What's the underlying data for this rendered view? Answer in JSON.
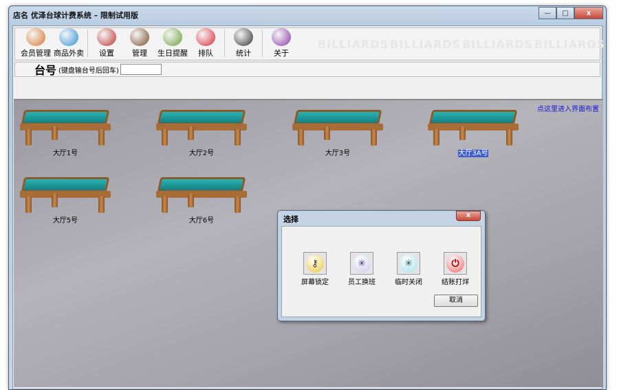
{
  "window": {
    "title": "店名 优泽台球计费系统  – 限制试用版",
    "minimize": "—",
    "maximize": "□",
    "close": "x"
  },
  "toolbar": {
    "watermark": "BILLIARDS",
    "items": [
      {
        "label": "会员管理",
        "icon": "members-icon",
        "color": "#d9732d"
      },
      {
        "label": "商品外卖",
        "icon": "pie-chart-icon",
        "color": "#2c8fd6"
      },
      {
        "label": "设置",
        "icon": "tools-icon",
        "color": "#b33"
      },
      {
        "label": "管理",
        "icon": "manager-icon",
        "color": "#7a4b2a"
      },
      {
        "label": "生日提醒",
        "icon": "group-icon",
        "color": "#6b9d3a"
      },
      {
        "label": "排队",
        "icon": "chart-down-icon",
        "color": "#d8283a"
      },
      {
        "label": "统计",
        "icon": "report-icon",
        "color": "#333"
      },
      {
        "label": "关于",
        "icon": "help-icon",
        "color": "#8a3aa8"
      }
    ]
  },
  "table_number": {
    "label": "台号",
    "hint": "(键盘输台号后回车)",
    "value": ""
  },
  "main": {
    "layout_link": "点这里进入界面布置",
    "tables": [
      "大厅1号",
      "大厅2号",
      "大厅3号",
      "大厅3A号",
      "大厅5号",
      "大厅6号"
    ]
  },
  "dialog": {
    "title": "选择",
    "close": "x",
    "actions": [
      {
        "label": "屏幕锁定",
        "icon": "key-icon",
        "glyph": "⚷",
        "bg": "#e8c73a",
        "fg": "#4a3a10"
      },
      {
        "label": "员工换班",
        "icon": "spinner-icon",
        "glyph": "✳",
        "bg": "#c9c9ec",
        "fg": "#333a80"
      },
      {
        "label": "临时关闭",
        "icon": "spinner-icon",
        "glyph": "✳",
        "bg": "#9fe0e8",
        "fg": "#1f5560"
      },
      {
        "label": "结账打烊",
        "icon": "power-icon",
        "glyph": "⏻",
        "bg": "#e86a6a",
        "fg": "#a00"
      }
    ],
    "cancel": "取消"
  }
}
